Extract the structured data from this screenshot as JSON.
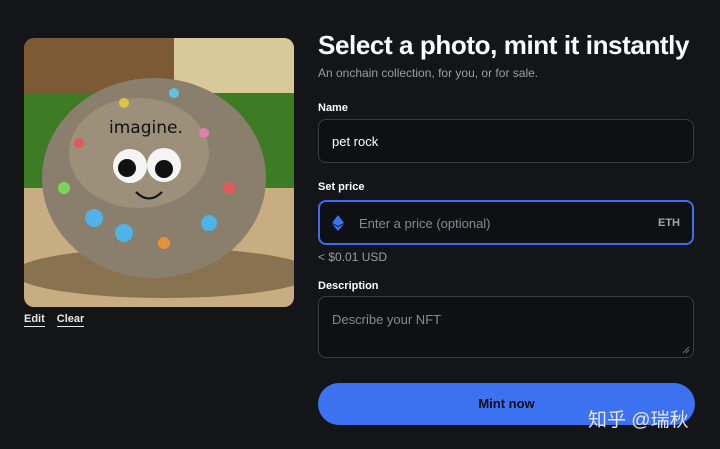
{
  "photo": {
    "alt": "pet rock with googly eyes",
    "painted_text": "imagine."
  },
  "photo_actions": {
    "edit": "Edit",
    "clear": "Clear"
  },
  "header": {
    "title": "Select a photo, mint it instantly",
    "subtitle": "An onchain collection, for you, or for sale."
  },
  "form": {
    "name_label": "Name",
    "name_value": "pet rock",
    "price_label": "Set price",
    "price_placeholder": "Enter a price (optional)",
    "price_unit": "ETH",
    "price_hint": "< $0.01 USD",
    "description_label": "Description",
    "description_placeholder": "Describe your NFT"
  },
  "mint_button": "Mint now",
  "watermark": "知乎 @瑞秋",
  "colors": {
    "background": "#141519",
    "accent": "#3c72f0",
    "input_border": "#3a3c44"
  }
}
